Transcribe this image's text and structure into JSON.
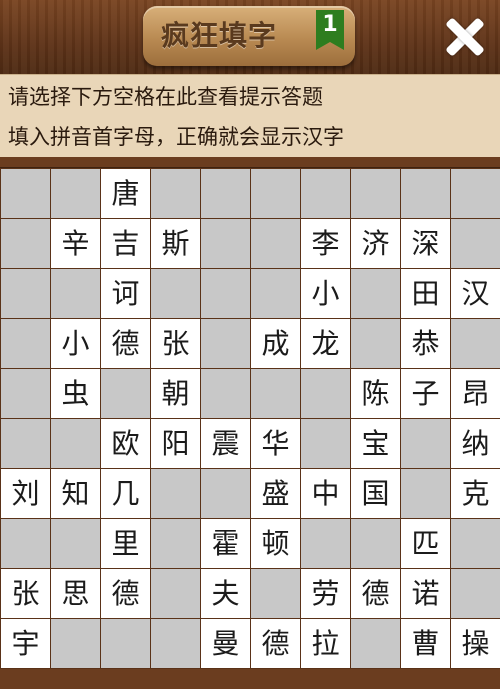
{
  "header": {
    "title": "疯狂填字",
    "level": "1"
  },
  "hint": {
    "line1": "请选择下方空格在此查看提示答题",
    "line2": "填入拼音首字母，正确就会显示汉字"
  },
  "grid": {
    "rows": [
      [
        "",
        "",
        "唐",
        "",
        "",
        "",
        "",
        "",
        "",
        ""
      ],
      [
        "",
        "辛",
        "吉",
        "斯",
        "",
        "",
        "李",
        "济",
        "深",
        ""
      ],
      [
        "",
        "",
        "诃",
        "",
        "",
        "",
        "小",
        "",
        "田",
        "汉"
      ],
      [
        "",
        "小",
        "德",
        "张",
        "",
        "成",
        "龙",
        "",
        "恭",
        ""
      ],
      [
        "",
        "虫",
        "",
        "朝",
        "",
        "",
        "",
        "陈",
        "子",
        "昂"
      ],
      [
        "",
        "",
        "欧",
        "阳",
        "震",
        "华",
        "",
        "宝",
        "",
        "纳"
      ],
      [
        "刘",
        "知",
        "几",
        "",
        "",
        "盛",
        "中",
        "国",
        "",
        "克"
      ],
      [
        "",
        "",
        "里",
        "",
        "霍",
        "顿",
        "",
        "",
        "匹",
        ""
      ],
      [
        "张",
        "思",
        "德",
        "",
        "夫",
        "",
        "劳",
        "德",
        "诺",
        ""
      ],
      [
        "宇",
        "",
        "",
        "",
        "曼",
        "德",
        "拉",
        "",
        "曹",
        "操"
      ]
    ],
    "white_cells": [
      [
        0,
        2
      ],
      [
        1,
        1
      ],
      [
        1,
        2
      ],
      [
        1,
        3
      ],
      [
        1,
        6
      ],
      [
        1,
        7
      ],
      [
        1,
        8
      ],
      [
        2,
        2
      ],
      [
        2,
        6
      ],
      [
        2,
        8
      ],
      [
        2,
        9
      ],
      [
        3,
        1
      ],
      [
        3,
        2
      ],
      [
        3,
        3
      ],
      [
        3,
        5
      ],
      [
        3,
        6
      ],
      [
        3,
        8
      ],
      [
        4,
        1
      ],
      [
        4,
        3
      ],
      [
        4,
        7
      ],
      [
        4,
        8
      ],
      [
        4,
        9
      ],
      [
        5,
        2
      ],
      [
        5,
        3
      ],
      [
        5,
        4
      ],
      [
        5,
        5
      ],
      [
        5,
        7
      ],
      [
        5,
        9
      ],
      [
        6,
        0
      ],
      [
        6,
        1
      ],
      [
        6,
        2
      ],
      [
        6,
        5
      ],
      [
        6,
        6
      ],
      [
        6,
        7
      ],
      [
        6,
        9
      ],
      [
        7,
        2
      ],
      [
        7,
        4
      ],
      [
        7,
        5
      ],
      [
        7,
        8
      ],
      [
        8,
        0
      ],
      [
        8,
        1
      ],
      [
        8,
        2
      ],
      [
        8,
        4
      ],
      [
        8,
        6
      ],
      [
        8,
        7
      ],
      [
        8,
        8
      ],
      [
        9,
        0
      ],
      [
        9,
        4
      ],
      [
        9,
        5
      ],
      [
        9,
        6
      ],
      [
        9,
        8
      ],
      [
        9,
        9
      ]
    ]
  },
  "icons": {
    "close": "close-icon"
  }
}
